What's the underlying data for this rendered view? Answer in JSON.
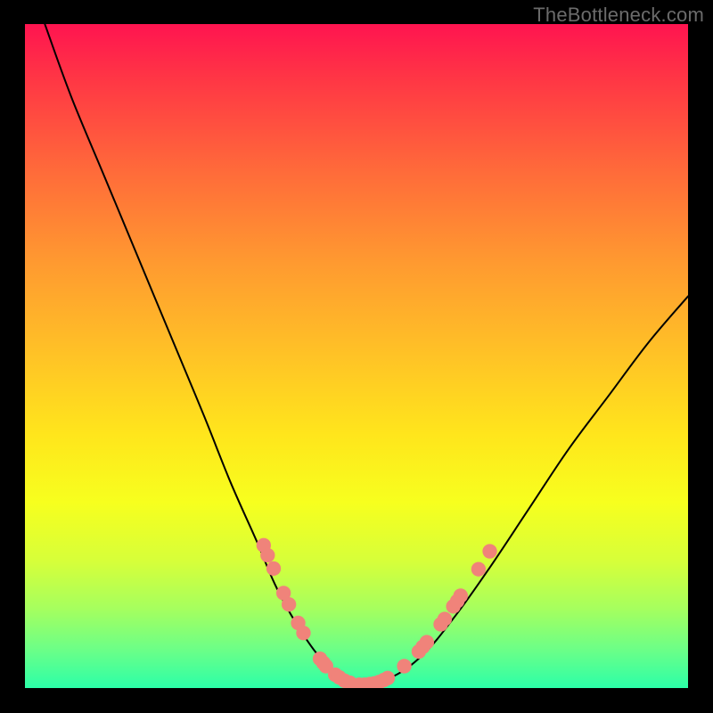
{
  "watermark": "TheBottleneck.com",
  "chart_data": {
    "type": "line",
    "title": "",
    "xlabel": "",
    "ylabel": "",
    "xlim": [
      0,
      100
    ],
    "ylim": [
      0,
      100
    ],
    "curve_left": [
      {
        "x": 3,
        "y": 100
      },
      {
        "x": 7,
        "y": 89
      },
      {
        "x": 12,
        "y": 77
      },
      {
        "x": 17,
        "y": 65
      },
      {
        "x": 22,
        "y": 53
      },
      {
        "x": 27,
        "y": 41
      },
      {
        "x": 31,
        "y": 31
      },
      {
        "x": 35,
        "y": 22
      },
      {
        "x": 38,
        "y": 15
      },
      {
        "x": 42,
        "y": 8
      },
      {
        "x": 46,
        "y": 3
      },
      {
        "x": 50,
        "y": 0.5
      }
    ],
    "curve_right": [
      {
        "x": 50,
        "y": 0.5
      },
      {
        "x": 55,
        "y": 1.5
      },
      {
        "x": 60,
        "y": 5
      },
      {
        "x": 65,
        "y": 11
      },
      {
        "x": 70,
        "y": 18
      },
      {
        "x": 76,
        "y": 27
      },
      {
        "x": 82,
        "y": 36
      },
      {
        "x": 88,
        "y": 44
      },
      {
        "x": 94,
        "y": 52
      },
      {
        "x": 100,
        "y": 59
      }
    ],
    "beads": [
      {
        "x": 36.0,
        "y": 21.5
      },
      {
        "x": 36.6,
        "y": 20.0
      },
      {
        "x": 37.5,
        "y": 18.0
      },
      {
        "x": 39.0,
        "y": 14.3
      },
      {
        "x": 39.8,
        "y": 12.6
      },
      {
        "x": 41.2,
        "y": 9.8
      },
      {
        "x": 42.0,
        "y": 8.3
      },
      {
        "x": 44.5,
        "y": 4.4
      },
      {
        "x": 45.0,
        "y": 3.8
      },
      {
        "x": 45.4,
        "y": 3.3
      },
      {
        "x": 46.8,
        "y": 2.0
      },
      {
        "x": 47.4,
        "y": 1.6
      },
      {
        "x": 48.2,
        "y": 1.1
      },
      {
        "x": 49.0,
        "y": 0.8
      },
      {
        "x": 50.4,
        "y": 0.5
      },
      {
        "x": 51.2,
        "y": 0.5
      },
      {
        "x": 52.0,
        "y": 0.6
      },
      {
        "x": 52.7,
        "y": 0.7
      },
      {
        "x": 53.4,
        "y": 0.9
      },
      {
        "x": 54.1,
        "y": 1.2
      },
      {
        "x": 54.7,
        "y": 1.5
      },
      {
        "x": 57.2,
        "y": 3.3
      },
      {
        "x": 59.4,
        "y": 5.5
      },
      {
        "x": 60.0,
        "y": 6.2
      },
      {
        "x": 60.6,
        "y": 6.9
      },
      {
        "x": 62.7,
        "y": 9.6
      },
      {
        "x": 63.3,
        "y": 10.4
      },
      {
        "x": 64.6,
        "y": 12.3
      },
      {
        "x": 65.2,
        "y": 13.1
      },
      {
        "x": 65.7,
        "y": 13.9
      },
      {
        "x": 68.4,
        "y": 17.9
      },
      {
        "x": 70.1,
        "y": 20.6
      }
    ],
    "bead_color": "#f0837a",
    "bead_radius": 1.1,
    "curve_color": "#000000"
  }
}
